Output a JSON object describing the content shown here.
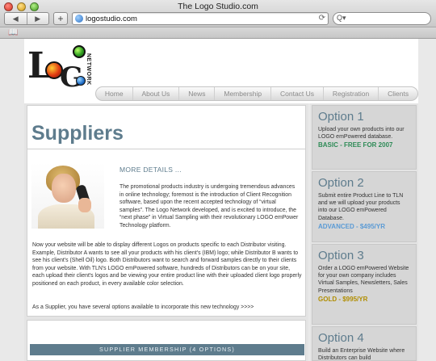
{
  "browser": {
    "window_title": "The Logo Studio.com",
    "url": "logostudio.com",
    "search_placeholder": "Q▾",
    "back_glyph": "◀",
    "forward_glyph": "▶",
    "new_tab_glyph": "+",
    "reload_glyph": "⟳",
    "bookmarks_glyph": "📖"
  },
  "logo": {
    "letter_l": "L",
    "letter_g": "G",
    "network": "NETWORK"
  },
  "nav": {
    "items": [
      "Home",
      "About Us",
      "News",
      "Membership",
      "Contact Us",
      "Registration",
      "Clients"
    ]
  },
  "main": {
    "heading": "Suppliers",
    "more_details": "MORE DETAILS ...",
    "intro": "The promotional products industry is undergoing tremendous advances in online technology; foremost is the introduction of Client Recognition software, based upon the recent accepted technology of “virtual samples”.  The Logo Network developed, and is excited to introduce, the “next phase” in Virtual Sampling with their revolutionary LOGO emPower Technology platform.",
    "body": "Now your website will be able to display different Logos on products specific to each Distributor visiting.  Example, Distributor A wants to see all your products with his client's (IBM) logo; while Distributor B wants to see his client's (Shell Oil) logo. Both Distributors want to search and forward samples directly to their clients from your website. With TLN's LOGO emPowered software, hundreds of Distributors can be on your site, each upload their client's logos and be viewing your entire product line with their uploaded client logo properly positioned on each product, in every available color selection.",
    "closing": "As a Supplier, you have several options available to incorporate this new technology >>>>",
    "membership_bar": "SUPPLIER MEMBERSHIP (4 OPTIONS)"
  },
  "sidebar": {
    "options": [
      {
        "title": "Option 1",
        "desc": "Upload your own products into our LOGO emPowered database.",
        "price": "BASIC - FREE FOR 2007",
        "price_color": "#2e8b57"
      },
      {
        "title": "Option 2",
        "desc": "Submit entire Product Line to TLN and we will upload your products into our LOGO emPowered Database.",
        "price": "ADVANCED - $495/YR",
        "price_color": "#5b9bd5"
      },
      {
        "title": "Option 3",
        "desc": "Order a LOGO emPowered Website for your own company includes Virtual Samples, Newsletters, Sales Presentations",
        "price": "GOLD - $995/YR",
        "price_color": "#b08d00"
      },
      {
        "title": "Option 4",
        "desc": "Build an Enterprise Website where Distributors can build",
        "price": "",
        "price_color": "#333333"
      }
    ]
  },
  "colors": {
    "accent": "#5e7c8d",
    "page_bg": "#e9e9e9"
  }
}
